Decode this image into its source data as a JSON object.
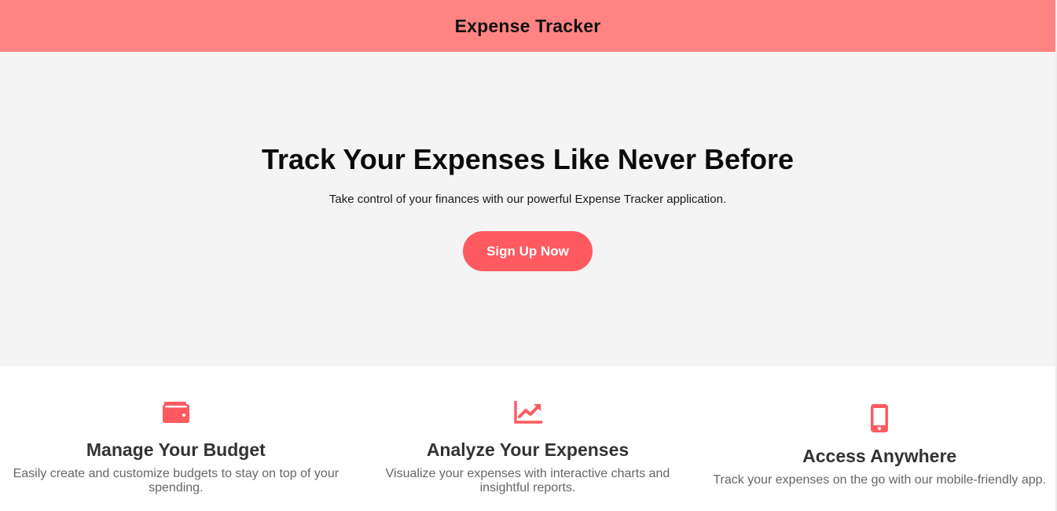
{
  "header": {
    "title": "Expense Tracker"
  },
  "hero": {
    "title": "Track Your Expenses Like Never Before",
    "subtitle": "Take control of your finances with our powerful Expense Tracker application.",
    "cta_label": "Sign Up Now"
  },
  "features": [
    {
      "icon": "wallet-icon",
      "title": "Manage Your Budget",
      "text": "Easily create and customize budgets to stay on top of your spending."
    },
    {
      "icon": "chart-line-icon",
      "title": "Analyze Your Expenses",
      "text": "Visualize your expenses with interactive charts and insightful reports."
    },
    {
      "icon": "mobile-phone-icon",
      "title": "Access Anywhere",
      "text": "Track your expenses on the go with our mobile-friendly app."
    }
  ],
  "colors": {
    "header_bg": "#ff8383",
    "accent": "#fe5a5f",
    "hero_bg": "#f4f4f4"
  }
}
